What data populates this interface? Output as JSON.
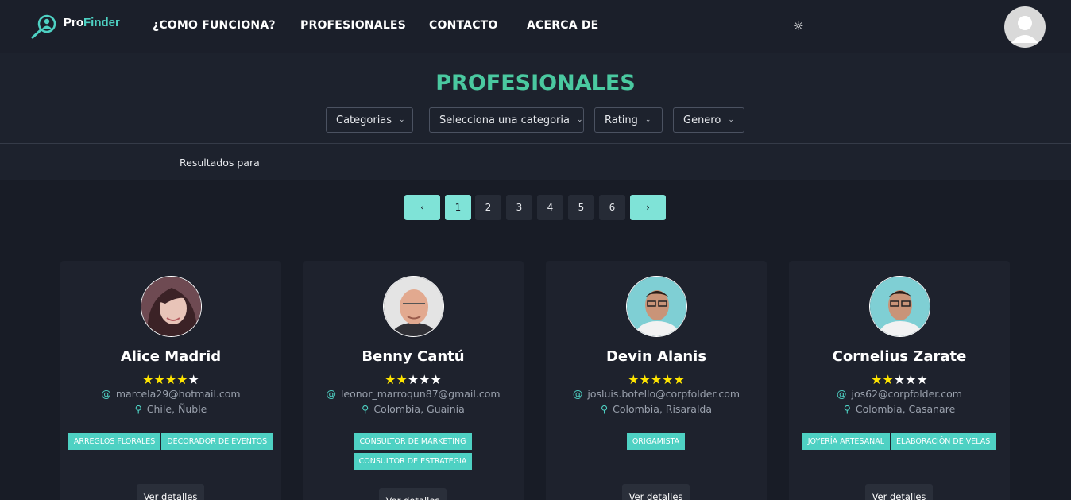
{
  "nav": {
    "logo_pro": "Pro",
    "logo_finder": "Finder",
    "links": [
      "¿COMO FUNCIONA?",
      "PROFESIONALES",
      "CONTACTO",
      "ACERCA DE"
    ],
    "theme_icon": "☼"
  },
  "header": {
    "title": "PROFESIONALES",
    "filters": [
      "Categorias",
      "Selecciona una categoria",
      "Rating",
      "Genero"
    ],
    "results_label": "Resultados para"
  },
  "pagination": {
    "prev": "‹",
    "next": "›",
    "pages": [
      "1",
      "2",
      "3",
      "4",
      "5",
      "6"
    ],
    "current": "1"
  },
  "cards": [
    {
      "name": "Alice Madrid",
      "rating": 4,
      "email": "marcela29@hotmail.com",
      "location": "Chile, Ñuble",
      "tags": [
        "ARREGLOS FLORALES",
        "DECORADOR DE EVENTOS"
      ],
      "button": "Ver detalles"
    },
    {
      "name": "Benny Cantú",
      "rating": 2,
      "email": "leonor_marroqun87@gmail.com",
      "location": "Colombia, Guainía",
      "tags": [
        "CONSULTOR DE MARKETING",
        "CONSULTOR DE ESTRATEGIA"
      ],
      "button": "Ver detalles"
    },
    {
      "name": "Devin Alanis",
      "rating": 5,
      "email": "josluis.botello@corpfolder.com",
      "location": "Colombia, Risaralda",
      "tags": [
        "ORIGAMISTA"
      ],
      "button": "Ver detalles"
    },
    {
      "name": "Cornelius Zarate",
      "rating": 2,
      "email": "jos62@corpfolder.com",
      "location": "Colombia, Casanare",
      "tags": [
        "JOYERÍA ARTESANAL",
        "ELABORACIÓN DE VELAS"
      ],
      "button": "Ver detalles"
    }
  ],
  "colors": {
    "accent": "#4ed1c3",
    "title": "#4ac9a0",
    "star_on": "#ffe500",
    "background": "#181c26"
  }
}
